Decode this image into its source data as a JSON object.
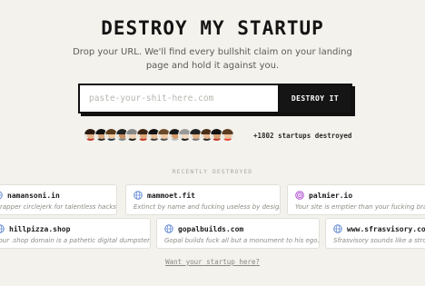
{
  "header": {
    "title": "DESTROY MY STARTUP",
    "subtitle": "Drop your URL. We'll find every bullshit claim on your landing page and hold it against you."
  },
  "form": {
    "placeholder": "paste-your-shit-here.com",
    "value": "",
    "button_label": "DESTROY IT"
  },
  "social_proof": {
    "avatar_count": 14,
    "count_text": "+1802 startups destroyed"
  },
  "recent": {
    "heading": "RECENTLY DESTROYED",
    "cards": [
      {
        "name": "namansoni.in",
        "desc": "A rapper circlejerk for talentless hacks.",
        "icon": "globe-icon",
        "color": "#6b8fd6"
      },
      {
        "name": "mammoet.fit",
        "desc": "Extinct by name and fucking useless by design.",
        "icon": "globe-icon",
        "color": "#6b8fd6"
      },
      {
        "name": "palmier.io",
        "desc": "Your site is emptier than your fucking brain.",
        "icon": "spiral-icon",
        "color": "#b14fd0"
      },
      {
        "name": "hillpizza.shop",
        "desc": "Your .shop domain is a pathetic digital dumpster.",
        "icon": "globe-icon",
        "color": "#6b8fd6"
      },
      {
        "name": "gopalbuilds.com",
        "desc": "Gopal builds fuck all but a monument to his ego.",
        "icon": "globe-icon",
        "color": "#6b8fd6"
      },
      {
        "name": "www.sfrasvisory.com",
        "desc": "Sfrasvisory sounds like a stroke.",
        "icon": "globe-icon",
        "color": "#6b8fd6"
      }
    ]
  },
  "footer": {
    "link": "Want your startup here?"
  },
  "colors": {
    "background": "#f4f2ec",
    "ink": "#151515",
    "muted": "#8d8b85"
  }
}
